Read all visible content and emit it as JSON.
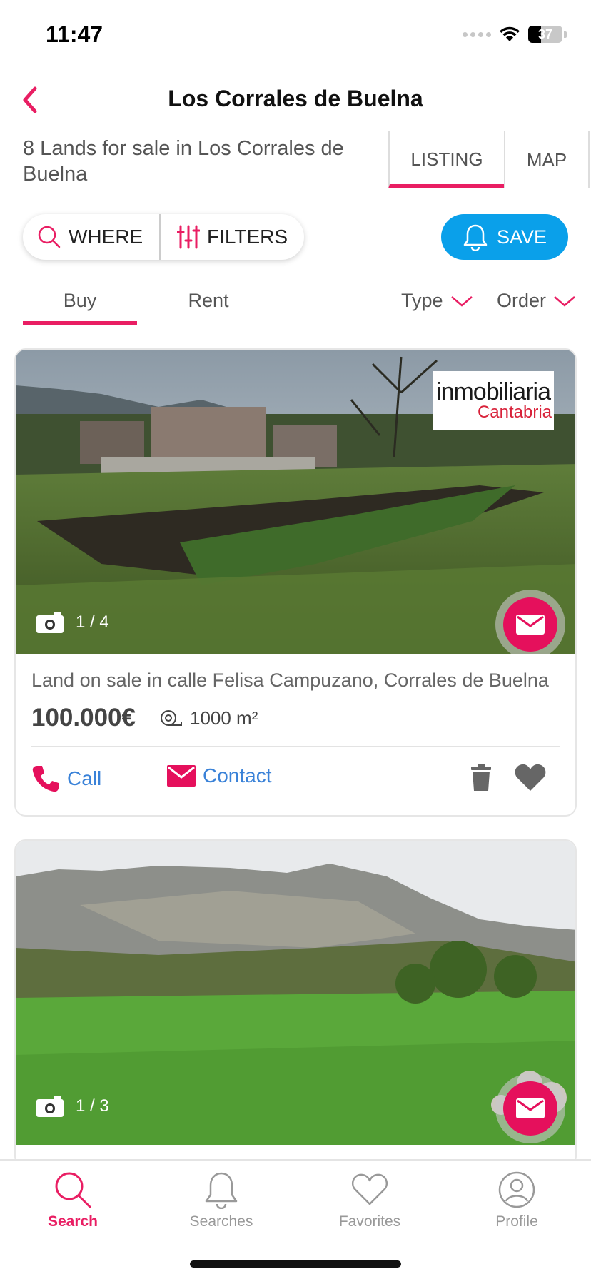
{
  "status_bar": {
    "time": "11:47",
    "battery": "37"
  },
  "header": {
    "title": "Los Corrales de Buelna"
  },
  "subheader": {
    "result_count": "8 Lands for sale in Los Corrales de Buelna",
    "tabs": [
      "LISTING",
      "MAP"
    ],
    "active_tab": "LISTING"
  },
  "filters": {
    "where_label": "WHERE",
    "filters_label": "FILTERS",
    "save_label": "SAVE"
  },
  "operation": {
    "tabs": [
      "Buy",
      "Rent"
    ],
    "active": "Buy",
    "type_label": "Type",
    "order_label": "Order"
  },
  "listings": [
    {
      "image_counter": "1 / 4",
      "agency_logo": {
        "line1": "inmobiliaria",
        "line2": "Cantabria"
      },
      "title": "Land on sale in calle Felisa Campuzano, Corrales de Buelna",
      "price": "100.000€",
      "area": "1000 m²",
      "call_label": "Call",
      "contact_label": "Contact"
    },
    {
      "image_counter": "1 / 3"
    }
  ],
  "bottom_nav": [
    {
      "label": "Search",
      "icon": "search-icon",
      "active": true
    },
    {
      "label": "Searches",
      "icon": "bell-icon",
      "active": false
    },
    {
      "label": "Favorites",
      "icon": "heart-icon",
      "active": false
    },
    {
      "label": "Profile",
      "icon": "profile-icon",
      "active": false
    }
  ],
  "colors": {
    "accent": "#e91e63",
    "save_button": "#0aa0ea",
    "link": "#3a82d8"
  }
}
